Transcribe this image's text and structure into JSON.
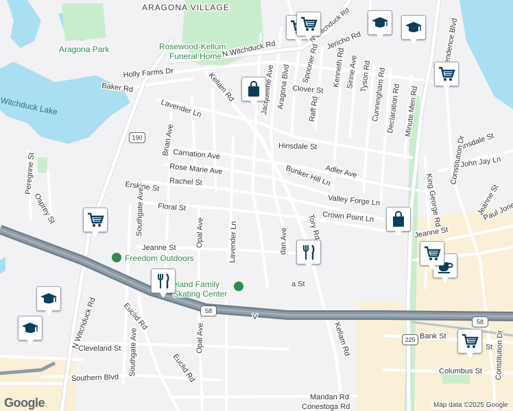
{
  "map": {
    "attribution": "Map data ©2025 Google",
    "logo": "Google",
    "colors": {
      "water": "#a9dff0",
      "park": "#c9eccd",
      "highway": "#7d8c99",
      "road": "#ffffff",
      "land": "#f2f2f4",
      "commercial": "#faf0d8",
      "pin_icon": "#0b3d5c"
    }
  },
  "areas": {
    "aragona_village": "ARAGONA VILLAGE",
    "aragona_park": "Aragona Park",
    "witchduck_lake": "Witchduck Lake"
  },
  "pois": {
    "funeral_home_line1": "Rosewood-Kellum",
    "funeral_home_line2": "Funeral Home",
    "freedom_outdoors": "Freedom Outdoors",
    "skating_center_line1": "eland Family",
    "skating_center_line2": "Skating Center"
  },
  "streets": {
    "n_witchduck_rd_top": "N Witchduck Rd",
    "n_witchduck_rd_left": "N Witchduck Rd",
    "jericho_rd": "Jericho Rd",
    "holly_farms_dr": "Holly Farms Dr",
    "baker_rd": "Baker Rd",
    "kellam_rd_top": "Kellam Rd",
    "kellam_rd_bottom": "Kellam Rd",
    "jacqueline_ave": "Jacqueline Ave",
    "aragona_blvd": "Aragona Blvd",
    "spooner_rd": "Spooner Rd",
    "kenneth_rd": "Kenneth Rd",
    "sirine_ave": "Sirine Ave",
    "tyson_rd": "Tyson Rd",
    "cunningham_rd": "Cunningham Rd",
    "declaration_rd": "Declaration Rd",
    "minute_men_rd": "Minute Men Rd",
    "clover_st": "Clover St",
    "raff_rd": "Raff Rd",
    "lavender_ln_top": "Lavender Ln",
    "lavender_ln_bottom": "Lavender Ln",
    "brian_ave": "Brian Ave",
    "carnation_ave": "Carnation Ave",
    "rose_marie_ave": "Rose Marie Ave",
    "rachel_st": "Rachel St",
    "erskine_st": "Erskine St",
    "floral_st": "Floral St",
    "hinsdale_st": "Hinsdale St",
    "hinsdale_st_east": "Hinsdale St",
    "adler_ave": "Adler Ave",
    "bunker_hill_ln": "Bunker Hill Ln",
    "valley_forge_ln": "Valley Forge Ln",
    "crown_point_ln": "Crown Point Ln",
    "tory_rd": "Tory Rd",
    "jordan_ave": "dan Ave",
    "jeanne_st_west": "Jeanne St",
    "jeanne_st_east": "Jeanne St",
    "jeanne_st_far": "Jeanne St",
    "peregrine_st": "Peregrine St",
    "osprey_st": "Osprey St",
    "southgate_ave_top": "Southgate Ave",
    "southgate_ave_bottom": "Southgate Ave",
    "opal_ave_top": "Opal Ave",
    "opal_ave_bottom": "Opal Ave",
    "euclid_rd_top": "Euclid Rd",
    "euclid_rd_bottom": "Euclid Rd",
    "cleveland_st": "Cleveland St",
    "southern_blvd": "Southern Blvd",
    "mandan_rd": "Mandan Rd",
    "conestoga_rd": "Conestoga Rd",
    "constitution_dr_top": "Constitution Dr",
    "constitution_dr_bottom": "Constitution Dr",
    "independence_blvd": "Independence Blvd",
    "john_jay_ln": "John Jay Ln",
    "king_george_rd": "King George Rd",
    "paul_jones": "Paul Jones",
    "bank_st": "Bank St",
    "columbus_st": "Columbus St",
    "st_partial": "St",
    "ra_st": "a St",
    "v_partial": "V"
  },
  "shields": {
    "sr190": "190",
    "us58_west": "58",
    "us58_east": "58",
    "i225": "225"
  },
  "pins": [
    {
      "type": "shopping-cart"
    },
    {
      "type": "shopping-cart"
    },
    {
      "type": "graduation-cap"
    },
    {
      "type": "graduation-cap"
    },
    {
      "type": "shopping-cart"
    },
    {
      "type": "shopping-bag"
    },
    {
      "type": "shopping-cart"
    },
    {
      "type": "shopping-bag"
    },
    {
      "type": "restaurant"
    },
    {
      "type": "coffee"
    },
    {
      "type": "shopping-cart"
    },
    {
      "type": "restaurant"
    },
    {
      "type": "shopping-cart"
    },
    {
      "type": "graduation-cap"
    },
    {
      "type": "graduation-cap"
    }
  ]
}
